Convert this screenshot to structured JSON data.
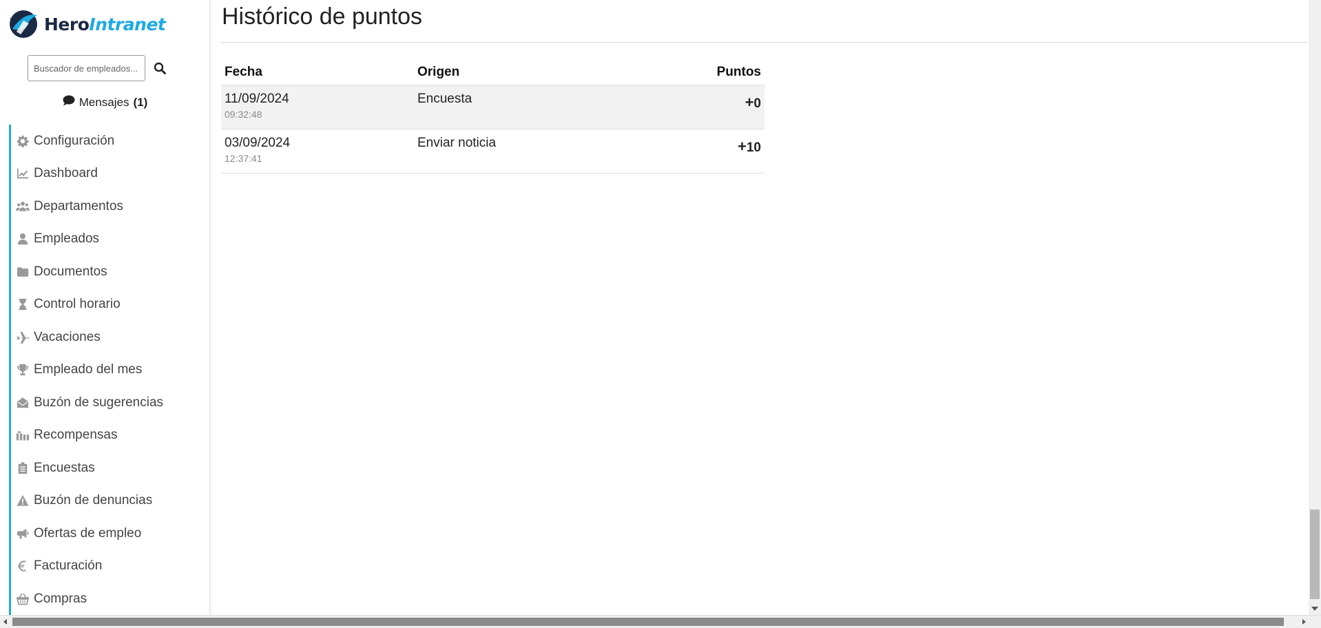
{
  "brand": {
    "name_part1": "Hero",
    "name_part2": "Intranet"
  },
  "search": {
    "placeholder": "Buscador de empleados..."
  },
  "messages": {
    "label": "Mensajes",
    "count": "(1)"
  },
  "sidebar": {
    "items": [
      {
        "label": "Configuración",
        "icon": "gear-icon"
      },
      {
        "label": "Dashboard",
        "icon": "chart-line-icon"
      },
      {
        "label": "Departamentos",
        "icon": "users-icon"
      },
      {
        "label": "Empleados",
        "icon": "user-icon"
      },
      {
        "label": "Documentos",
        "icon": "folder-icon"
      },
      {
        "label": "Control horario",
        "icon": "hourglass-icon"
      },
      {
        "label": "Vacaciones",
        "icon": "plane-icon"
      },
      {
        "label": "Empleado del mes",
        "icon": "trophy-icon"
      },
      {
        "label": "Buzón de sugerencias",
        "icon": "envelope-open-icon"
      },
      {
        "label": "Recompensas",
        "icon": "gift-icon"
      },
      {
        "label": "Encuestas",
        "icon": "clipboard-icon"
      },
      {
        "label": "Buzón de denuncias",
        "icon": "warning-icon"
      },
      {
        "label": "Ofertas de empleo",
        "icon": "bullhorn-icon"
      },
      {
        "label": "Facturación",
        "icon": "euro-icon"
      },
      {
        "label": "Compras",
        "icon": "basket-icon"
      }
    ]
  },
  "main": {
    "title": "Histórico de puntos",
    "columns": {
      "date": "Fecha",
      "origin": "Origen",
      "points": "Puntos"
    },
    "rows": [
      {
        "date": "11/09/2024",
        "time": "09:32:48",
        "origin": "Encuesta",
        "sign": "+",
        "points": "0"
      },
      {
        "date": "03/09/2024",
        "time": "12:37:41",
        "origin": "Enviar noticia",
        "sign": "+",
        "points": "10"
      }
    ]
  },
  "colors": {
    "accent": "#1fa9e2",
    "brand_dark": "#1a2a44"
  }
}
